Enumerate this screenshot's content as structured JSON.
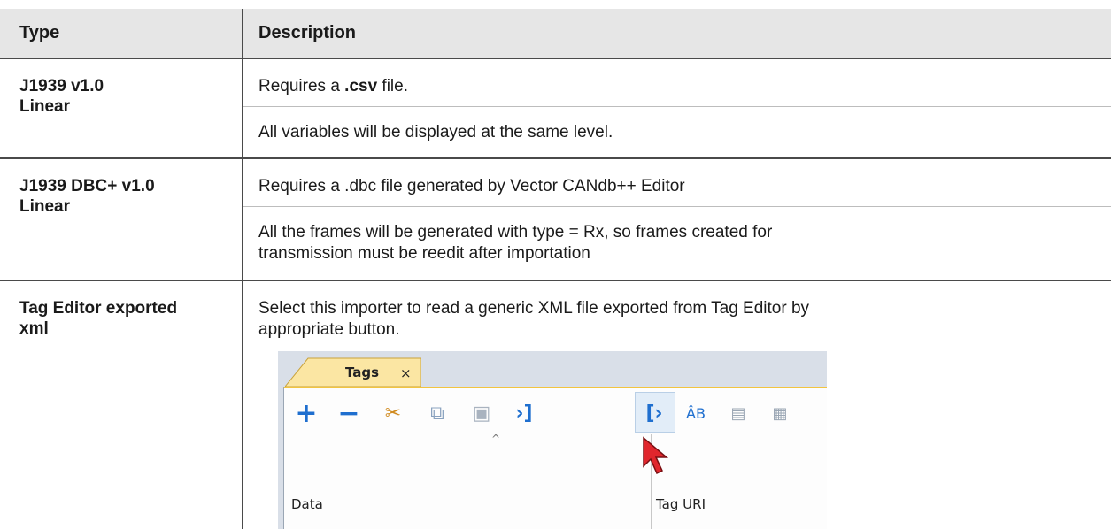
{
  "table": {
    "headers": {
      "type": "Type",
      "description": "Description"
    },
    "rows": [
      {
        "type_line1": "J1939 v1.0",
        "type_line2": "Linear",
        "desc1_pre": "Requires a ",
        "desc1_bold": ".csv",
        "desc1_post": " file.",
        "desc2": "All variables will be displayed at the same level."
      },
      {
        "type_line1": "J1939 DBC+ v1.0",
        "type_line2": "Linear",
        "desc1": "Requires a .dbc file generated by Vector CANdb++ Editor",
        "desc2": "All the frames will be generated with type = Rx, so frames created for transmission must be reedit after importation"
      },
      {
        "type_line1": "Tag Editor exported",
        "type_line2": "xml",
        "desc1": "Select this importer to read a generic XML file exported from Tag Editor by appropriate button."
      }
    ]
  },
  "screenshot": {
    "tab_label": "Tags",
    "tab_close": "×",
    "column_data": "Data",
    "column_tag_uri": "Tag URI",
    "toolbar": [
      "plus-icon",
      "minus-icon",
      "cut-icon",
      "copy-icon",
      "paste-icon",
      "import-icon",
      "export-icon",
      "rename-icon",
      "filter-icon",
      "dictionary-icon"
    ]
  }
}
